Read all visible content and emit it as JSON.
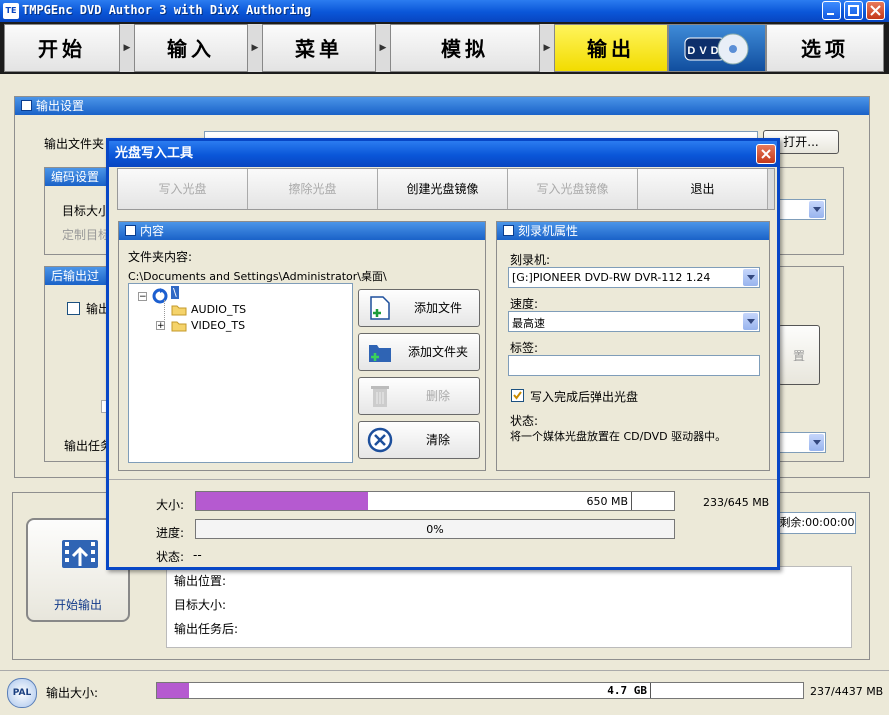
{
  "app": {
    "title": "TMPGEnc DVD Author 3 with DivX Authoring",
    "icon": "TE"
  },
  "steps": [
    {
      "label": "开始"
    },
    {
      "label": "输入"
    },
    {
      "label": "菜单"
    },
    {
      "label": "模拟"
    },
    {
      "label": "输出"
    },
    {
      "label": "DVD"
    },
    {
      "label": "选项"
    }
  ],
  "bg": {
    "output_settings_title": "输出设置",
    "output_folder_label": "输出文件夹",
    "open_button": "打开...",
    "encode_settings": "编码设置",
    "target_size_label": "目标大小",
    "custom_label": "定制目标",
    "post_output": "后输出过",
    "output_checkbox": "输出",
    "settings_btn": "置",
    "output_task_label": "输出任务",
    "remaining": "剩余:00:00:00",
    "start_output": "开始输出",
    "output_location": "输出位置:",
    "target_size": "目标大小:",
    "after_task": "输出任务后:",
    "pal": "PAL",
    "total_size_label": "输出大小:",
    "total_capacity": "4.7 GB",
    "total_fraction": 0.05,
    "total_mb": "237/4437 MB"
  },
  "dialog": {
    "title": "光盘写入工具",
    "toolbar": {
      "write_disc": "写入光盘",
      "erase_disc": "擦除光盘",
      "create_image": "创建光盘镜像",
      "write_image": "写入光盘镜像",
      "exit": "退出"
    },
    "content": {
      "title": "内容",
      "folder_label": "文件夹内容:",
      "path": "C:\\Documents and Settings\\Administrator\\桌面\\",
      "root": "\\",
      "tree": [
        "AUDIO_TS",
        "VIDEO_TS"
      ],
      "add_file": "添加文件",
      "add_folder": "添加文件夹",
      "delete": "删除",
      "clear": "清除"
    },
    "burner": {
      "title": "刻录机属性",
      "burner_label": "刻录机:",
      "burner_value": "[G:]PIONEER  DVD-RW  DVR-112  1.24",
      "speed_label": "速度:",
      "speed_value": "最高速",
      "label_label": "标签:",
      "label_value": "",
      "eject_label": "写入完成后弹出光盘",
      "eject_checked": true,
      "status_label": "状态:",
      "status_text": "将一个媒体光盘放置在 CD/DVD 驱动器中。"
    },
    "footer": {
      "size_label": "大小:",
      "size_capacity": "650 MB",
      "size_fraction": 0.36,
      "size_mb": "233/645 MB",
      "progress_label": "进度:",
      "progress_text": "0%",
      "state_label": "状态:",
      "state_value": "--"
    }
  },
  "colors": {
    "accent": "#0a56d8",
    "step_active": "#f5e000",
    "size_fill": "#b55ad0"
  }
}
